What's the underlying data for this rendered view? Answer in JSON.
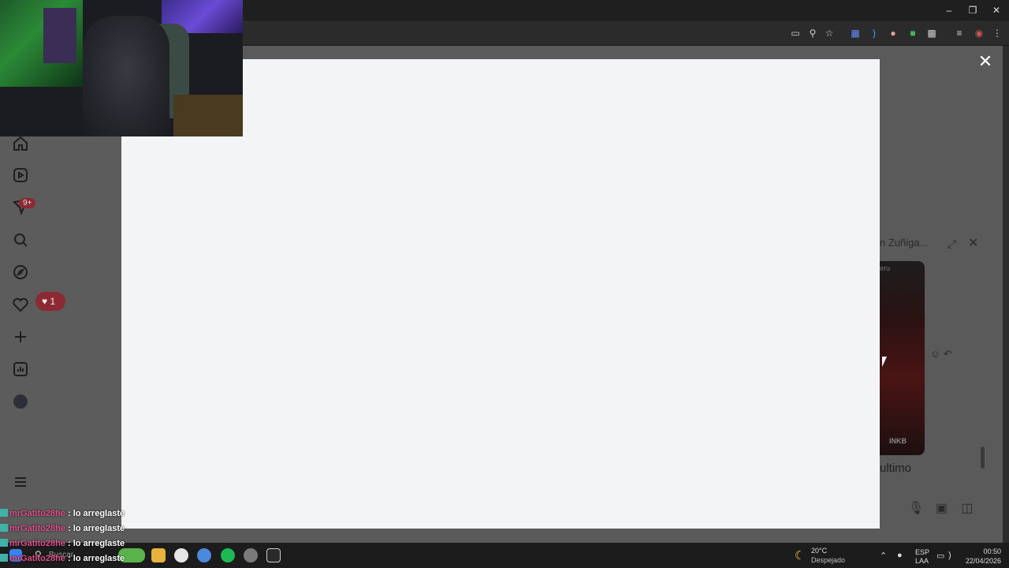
{
  "chat_panel": {
    "contact_name": "n Zuñiga...",
    "media_tag": "eru",
    "media_brand": "INKB",
    "message_preview": "ultimo"
  },
  "stream_chat": [
    {
      "user": "mrGatito28he",
      "message": "lo arreglaste"
    },
    {
      "user": "mrGatito28he",
      "message": "lo arreglaste"
    },
    {
      "user": "mrGatito28he",
      "message": "lo arreglaste"
    },
    {
      "user": "mrGatito28he",
      "message": "lo arreglaste"
    }
  ],
  "sidebar": {
    "notifications_badge": "9+",
    "likes_count": "1"
  },
  "taskbar": {
    "search_placeholder": "Buscar",
    "weather_temp": "20°C",
    "weather_desc": "Despejado",
    "lang_top": "ESP",
    "lang_bottom": "LAA",
    "time": "00:50",
    "date": "22/04/2026"
  },
  "icons": {
    "close": "close-icon",
    "expand": "expand-icon",
    "mic": "mic-icon",
    "image": "image-icon",
    "sticker": "sticker-icon"
  }
}
